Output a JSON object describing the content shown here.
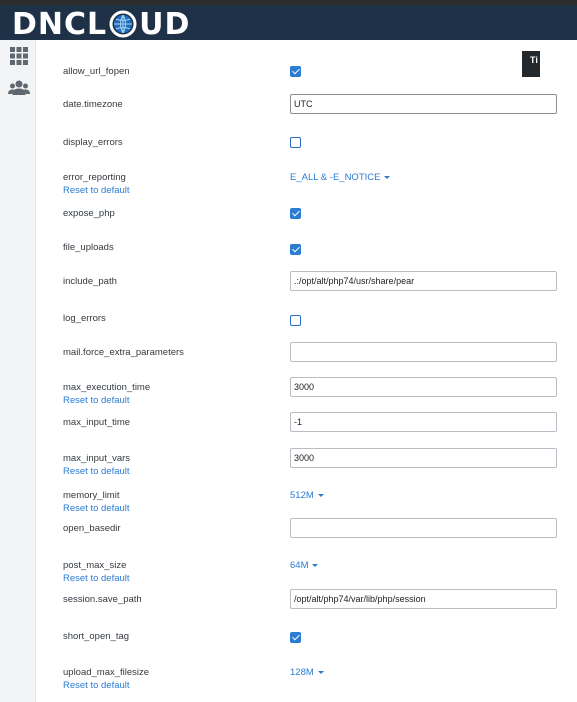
{
  "header": {
    "logo_text_left": "DNCL",
    "logo_text_right": "UD"
  },
  "sidebar": {
    "icons": [
      "grid-icon",
      "users-icon"
    ]
  },
  "tooltip": {
    "text": "Ti"
  },
  "settings": [
    {
      "name": "allow_url_fopen",
      "type": "checkbox",
      "checked": true
    },
    {
      "name": "date.timezone",
      "type": "input",
      "value": "UTC"
    },
    {
      "name": "display_errors",
      "type": "checkbox",
      "checked": false
    },
    {
      "name": "error_reporting",
      "type": "dropdown",
      "value": "E_ALL & -E_NOTICE",
      "reset": "Reset to default"
    },
    {
      "name": "expose_php",
      "type": "checkbox",
      "checked": true
    },
    {
      "name": "file_uploads",
      "type": "checkbox",
      "checked": true
    },
    {
      "name": "include_path",
      "type": "input",
      "value": ".:/opt/alt/php74/usr/share/pear"
    },
    {
      "name": "log_errors",
      "type": "checkbox",
      "checked": false
    },
    {
      "name": "mail.force_extra_parameters",
      "type": "input",
      "value": ""
    },
    {
      "name": "max_execution_time",
      "type": "input",
      "value": "3000",
      "reset": "Reset to default"
    },
    {
      "name": "max_input_time",
      "type": "input",
      "value": "-1"
    },
    {
      "name": "max_input_vars",
      "type": "input",
      "value": "3000",
      "reset": "Reset to default"
    },
    {
      "name": "memory_limit",
      "type": "dropdown",
      "value": "512M",
      "reset": "Reset to default"
    },
    {
      "name": "open_basedir",
      "type": "input",
      "value": ""
    },
    {
      "name": "post_max_size",
      "type": "dropdown",
      "value": "64M",
      "reset": "Reset to default"
    },
    {
      "name": "session.save_path",
      "type": "input",
      "value": "/opt/alt/php74/var/lib/php/session"
    },
    {
      "name": "short_open_tag",
      "type": "checkbox",
      "checked": true
    },
    {
      "name": "upload_max_filesize",
      "type": "dropdown",
      "value": "128M",
      "reset": "Reset to default"
    }
  ]
}
